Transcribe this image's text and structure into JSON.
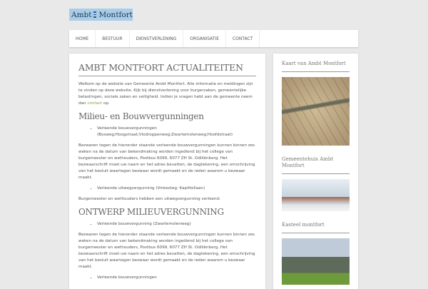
{
  "logo": {
    "left": "Ambt",
    "right": "Montfort"
  },
  "nav": [
    "HOME",
    "BESTUUR",
    "DIENSTVERLENING",
    "ORGANISATIE",
    "CONTACT"
  ],
  "main": {
    "title": "AMBT MONTFORT ACTUALITEITEN",
    "intro_a": "Welkom op de website van Gemeente Ambt Montfort. Alle informatie en meldingen zijn te vinden op deze website. Kijk bij dienstverlening voor burgerzaken, gemeentelijke belastingen, sociale zaken en veiligheid. Indien je vragen hebt aan de gemeente neem dan ",
    "intro_link": "contact",
    "intro_b": " op.",
    "h_milieu": "Milieu- en Bouwvergunningen",
    "item1": "Verleende bouwvergunningen (Bosweg;Hoogstraat;Vlodroppenweg;Zwartemolenweg;Hoofdstraat)",
    "bezwaar": "Bezwaren tegen de hieronder staande verleende bouwvergunningen kunnen binnen zes weken na de datum van bekendmaking worden ingediend bij het college van burgemeester en wethouders, Postbus 6099, 6077 ZH St. Odiliënberg. Het bezwaarschrift moet uw naam en het adres bevatten, de dagtekening, een omschrijving van het besluit waartegen bezwaar wordt gemaakt en de reden waarom u bezwaar maakt.",
    "item2": "Verleende uitwegvergunning (Vinkesteg; Kapittellaan)",
    "uitweg": "Burgemeester en wethouders hebben een uitwegvergunning verleend:",
    "h_ontwerp": "ONTWERP MILIEUVERGUNNING",
    "item3": "Verleende bouwvergunning (Zwartemolenweg)",
    "item4": "Verleende bouwvergunningen"
  },
  "sidebar": {
    "w1": "Kaart van Ambt Montfort",
    "w2": "Gemeentehuis Ambt Montfort",
    "w3": "Kasteel montfort"
  }
}
